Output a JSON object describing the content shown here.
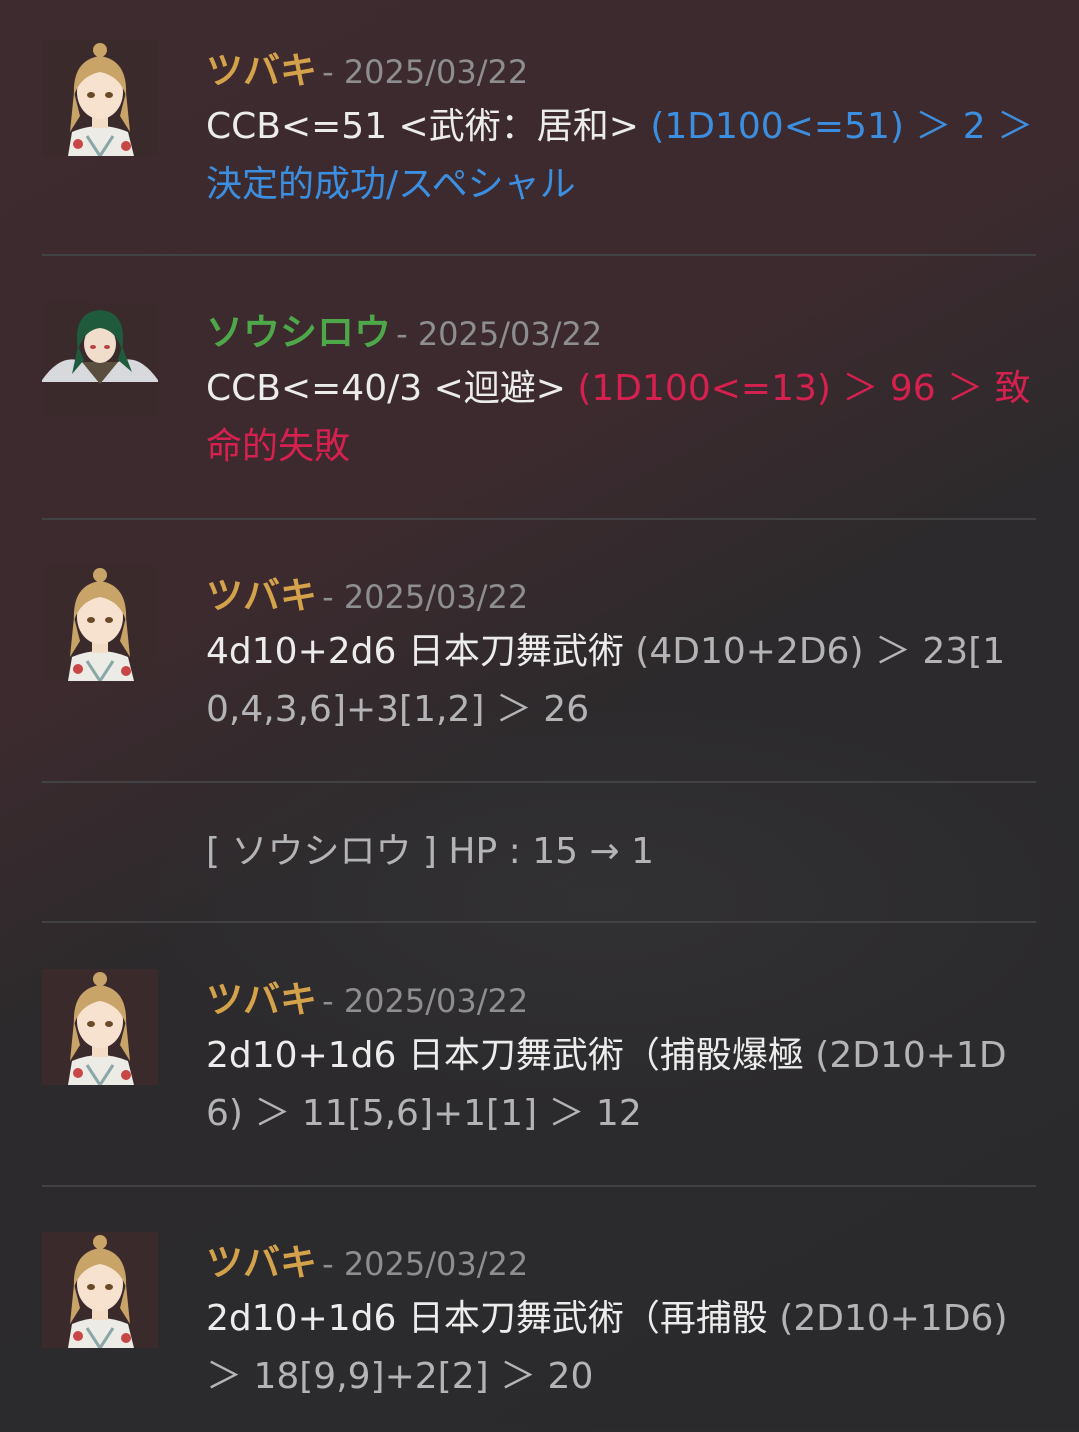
{
  "colors": {
    "tsubaki": "#d4a24a",
    "soushirou": "#4ea84a",
    "success": "#3c8fe0",
    "fumble": "#d6204f"
  },
  "entries": [
    {
      "speaker": "ツバキ",
      "date": "- 2025/03/22",
      "command": "CCB<=51 <武術：居和> ",
      "result": "(1D100<=51) ＞ 2 ＞ 決定的成功/スペシャル",
      "avatar": "tsubaki-portrait"
    },
    {
      "speaker": "ソウシロウ",
      "date": "- 2025/03/22",
      "command": "CCB<=40/3 <迴避> ",
      "result": "(1D100<=13) ＞ 96 ＞ 致命的失敗",
      "avatar": "soushirou-portrait"
    },
    {
      "speaker": "ツバキ",
      "date": "- 2025/03/22",
      "command": "4d10+2d6 日本刀舞武術 ",
      "result": "(4D10+2D6) ＞ 23[10,4,3,6]+3[1,2] ＞ 26",
      "avatar": "tsubaki-portrait"
    },
    {
      "system": "[ ソウシロウ ] HP : 15 → 1"
    },
    {
      "speaker": "ツバキ",
      "date": "- 2025/03/22",
      "command": "2d10+1d6 日本刀舞武術（捕骰爆極 ",
      "result": "(2D10+1D6) ＞ 11[5,6]+1[1] ＞ 12",
      "avatar": "tsubaki-portrait"
    },
    {
      "speaker": "ツバキ",
      "date": "- 2025/03/22",
      "command": "2d10+1d6 日本刀舞武術（再捕骰 ",
      "result": "(2D10+1D6) ＞ 18[9,9]+2[2] ＞ 20",
      "avatar": "tsubaki-portrait"
    }
  ]
}
